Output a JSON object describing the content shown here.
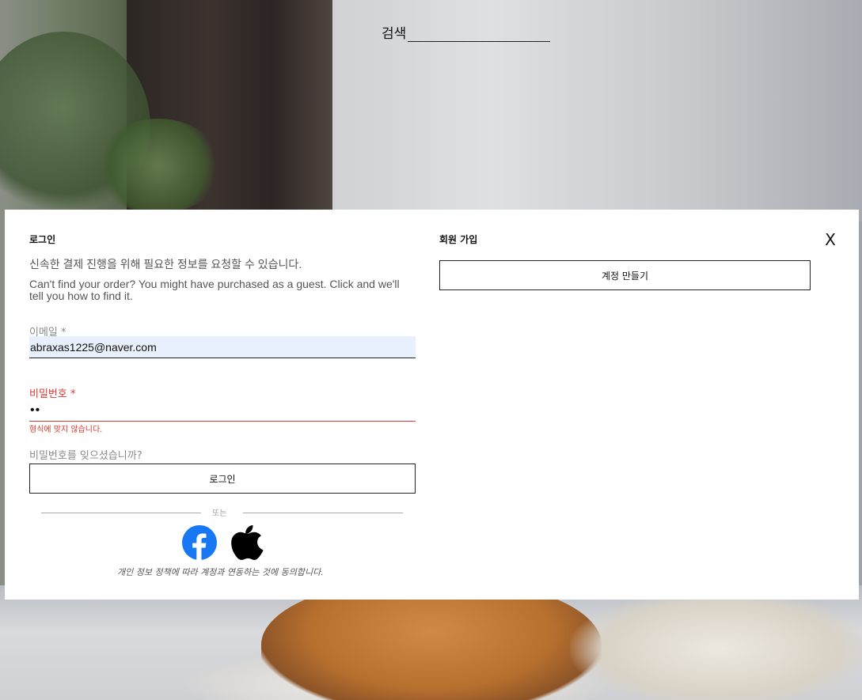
{
  "search": {
    "label": "검색"
  },
  "login": {
    "title": "로그인",
    "intro": "신속한 결제 진행을 위해 필요한 정보를 요청할 수 있습니다.",
    "guest_note": "Can't find your order? You might have purchased as a guest. Click and we'll tell you how to find it.",
    "email_label": "이메일 *",
    "email_value": "abraxas1225@naver.com",
    "password_label": "비밀번호 *",
    "password_value": "••",
    "password_error": "형식에 맞지 않습니다.",
    "forgot_link": "비밀번호를 잊으셨습니까?",
    "login_button": "로그인",
    "or_text": "또는",
    "consent": "개인 정보 정책에 따라 계정과 연동하는 것에 동의합니다."
  },
  "signup": {
    "title": "회원 가입",
    "create_button": "계정 만들기"
  },
  "close": {
    "label": "X"
  },
  "colors": {
    "error": "#d83a2f",
    "facebook": "#1877f2",
    "autofill_bg": "#e8f0fe"
  },
  "icons": {
    "social": [
      "facebook-icon",
      "apple-icon"
    ],
    "close": "close-icon"
  }
}
